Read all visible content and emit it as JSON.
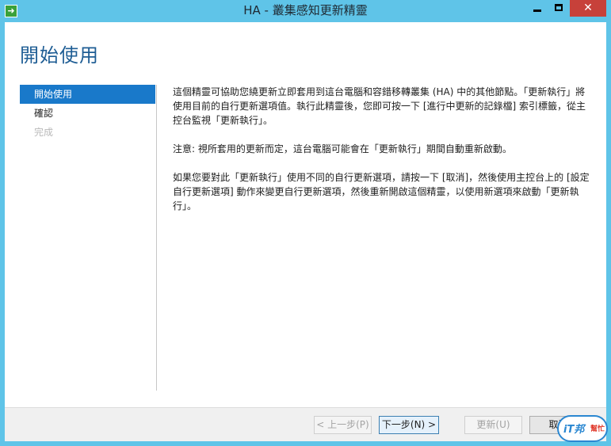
{
  "window": {
    "title": "HA - 叢集感知更新精靈",
    "app_icon": "arrow-right-icon",
    "controls": {
      "minimize": "minimize-icon",
      "maximize": "maximize-icon",
      "close": "✕"
    }
  },
  "page": {
    "title": "開始使用"
  },
  "nav": {
    "items": [
      {
        "label": "開始使用",
        "state": "active"
      },
      {
        "label": "確認",
        "state": "normal"
      },
      {
        "label": "完成",
        "state": "disabled"
      }
    ]
  },
  "content": {
    "paragraphs": [
      "這個精靈可協助您繞更新立即套用到這台電腦和容錯移轉叢集 (HA) 中的其他節點。「更新執行」將使用目前的自行更新選項值。執行此精靈後，您即可按一下 [進行中更新的記錄檔] 索引標籤，從主控台監視「更新執行」。",
      "注意: 視所套用的更新而定，這台電腦可能會在「更新執行」期間自動重新啟動。",
      "如果您要對此「更新執行」使用不同的自行更新選項，請按一下 [取消]，然後使用主控台上的 [設定自行更新選項] 動作來變更自行更新選項，然後重新開啟這個精靈，以使用新選項來啟動「更新執行」。"
    ]
  },
  "footer": {
    "prev": "< 上一步(P)",
    "next": "下一步(N) >",
    "update": "更新(U)",
    "cancel": "取消"
  },
  "watermark": {
    "text": "iT邦",
    "sub": "幫忙"
  },
  "colors": {
    "frame": "#5fc4e8",
    "accent": "#1979ca",
    "title": "#1e5d94",
    "close": "#c7413a"
  }
}
